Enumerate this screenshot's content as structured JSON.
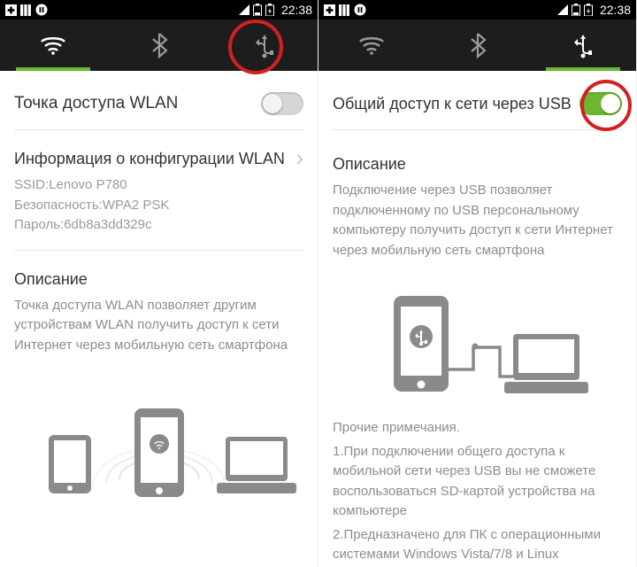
{
  "left": {
    "status": {
      "time": "22:38"
    },
    "active_tab": "wifi",
    "toggle": {
      "label": "Точка доступа WLAN",
      "on": false
    },
    "config": {
      "title": "Информация о конфигурации WLAN",
      "ssid_label": "SSID:",
      "ssid": "Lenovo P780",
      "security_label": "Безопасность:",
      "security": "WPA2 PSK",
      "password_label": "Пароль:",
      "password": "6db8a3dd329c"
    },
    "desc_title": "Описание",
    "desc_text": "Точка доступа WLAN позволяет другим устройствам WLAN получить доступ к сети Интернет через мобильную сеть смартфона"
  },
  "right": {
    "status": {
      "time": "22:38"
    },
    "active_tab": "usb",
    "toggle": {
      "label": "Общий доступ к сети через USB",
      "on": true
    },
    "desc_title": "Описание",
    "desc_text": "Подключение через USB позволяет подключенному по USB персональному компьютеру получить доступ к сети Интернет через мобильную сеть смартфона",
    "notes_title": "Прочие примечания.",
    "note1": "1.При подключении общего доступа к мобильной сети через USB вы не сможете воспользоваться SD-картой устройства на компьютере",
    "note2": "2.Предназначено для ПК с операционными системами Windows Vista/7/8 и Linux"
  }
}
